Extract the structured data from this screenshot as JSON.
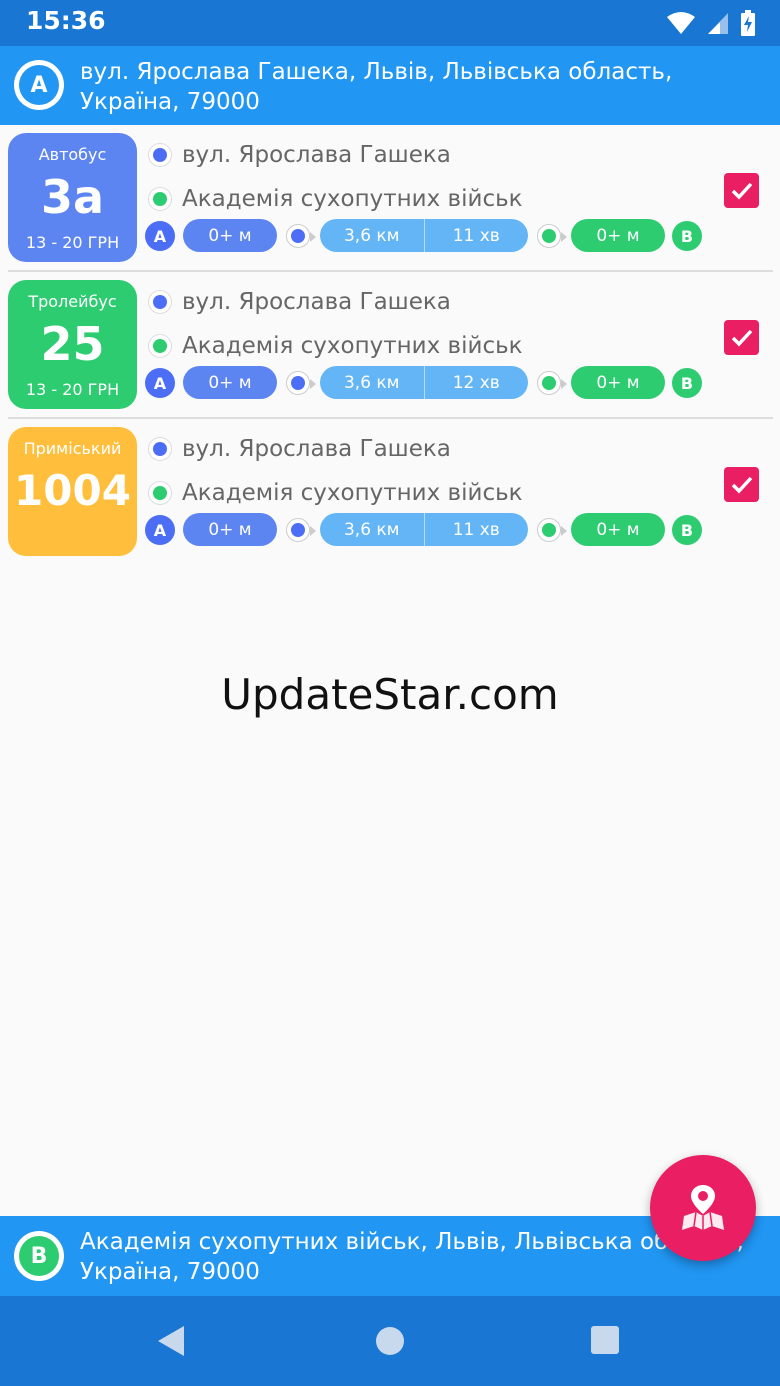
{
  "status_bar": {
    "time": "15:36"
  },
  "from": {
    "badge": "A",
    "address": "вул. Ярослава Гашека, Львів, Львівська область, Україна, 79000"
  },
  "to": {
    "badge": "B",
    "address": "Академія сухопутних військ, Львів, Львівська область, Україна, 79000"
  },
  "routes": [
    {
      "type": "Автобус",
      "number": "3а",
      "price": "13 - 20 ГРН",
      "color": "#5C85F2",
      "from_stop": "вул. Ярослава Гашека",
      "to_stop": "Академія сухопутних військ",
      "pin_a": "A",
      "walk_start": "0+ м",
      "distance": "3,6 км",
      "duration": "11 хв",
      "walk_end": "0+ м",
      "pin_b": "B",
      "checked": true
    },
    {
      "type": "Тролейбус",
      "number": "25",
      "price": "13 - 20 ГРН",
      "color": "#2DCC70",
      "from_stop": "вул. Ярослава Гашека",
      "to_stop": "Академія сухопутних військ",
      "pin_a": "A",
      "walk_start": "0+ м",
      "distance": "3,6 км",
      "duration": "12 хв",
      "walk_end": "0+ м",
      "pin_b": "B",
      "checked": true
    },
    {
      "type": "Приміський",
      "number": "1004",
      "price": "",
      "color": "#FFBF3C",
      "from_stop": "вул. Ярослава Гашека",
      "to_stop": "Академія сухопутних військ",
      "pin_a": "A",
      "walk_start": "0+ м",
      "distance": "3,6 км",
      "duration": "11 хв",
      "walk_end": "0+ м",
      "pin_b": "B",
      "checked": true
    }
  ],
  "watermark": "UpdateStar.com",
  "fab": {
    "icon": "map-pin-icon"
  },
  "colors": {
    "primary": "#2196F3",
    "primary_dark": "#1976D2",
    "accent": "#E91E63",
    "blue_pin": "#4C6EF5",
    "green_pin": "#2DCC70",
    "walk_pill": "#5C85F2",
    "ride_pill": "#64B5F6",
    "end_pill": "#2DCC70"
  }
}
